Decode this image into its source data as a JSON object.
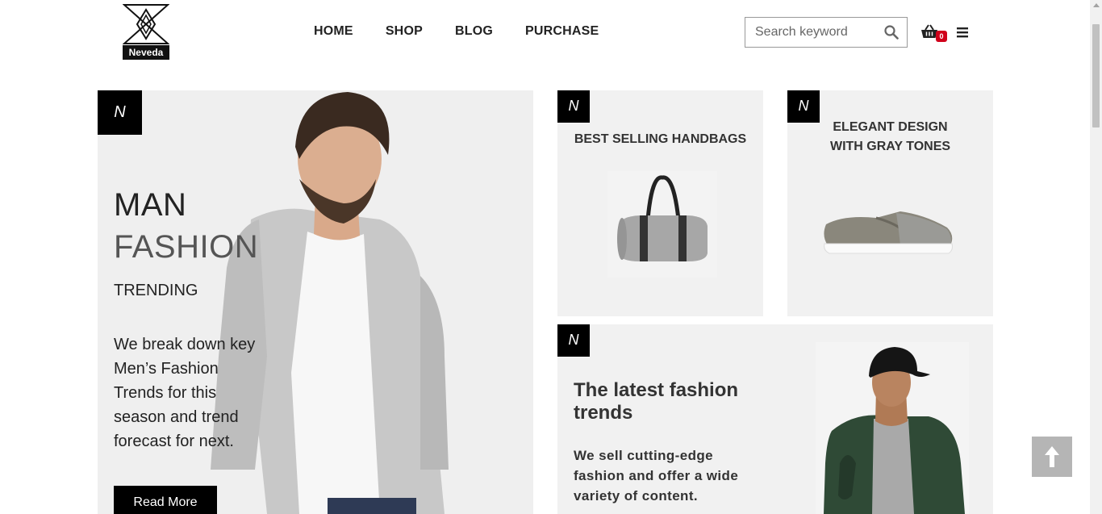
{
  "brand": {
    "name": "Neveda"
  },
  "nav": {
    "home": "HOME",
    "shop": "SHOP",
    "blog": "BLOG",
    "purchase": "PURCHASE"
  },
  "search": {
    "placeholder": "Search keyword",
    "icon": "search-icon"
  },
  "cart": {
    "count": "0",
    "icon": "shopping-basket-icon"
  },
  "menu": {
    "icon": "hamburger-menu-icon"
  },
  "hero": {
    "badge": "N",
    "title_line1": "MAN",
    "title_line2": "FASHION",
    "subtitle": "TRENDING",
    "description": "We break down key Men’s Fashion Trends for this season and trend forecast for next.",
    "button_label": "Read More"
  },
  "card_handbags": {
    "badge": "N",
    "title": "BEST SELLING HANDBAGS"
  },
  "card_shoes": {
    "badge": "N",
    "title": "ELEGANT DESIGN WITH GRAY TONES"
  },
  "card_latest": {
    "badge": "N",
    "title": "The latest fashion trends",
    "description": "We sell cutting-edge fashion and offer a wide variety of content."
  },
  "back_to_top": {
    "icon": "arrow-up-icon"
  },
  "colors": {
    "accent": "#000000",
    "panel": "#f1f1f1",
    "badge": "#d0021b"
  }
}
